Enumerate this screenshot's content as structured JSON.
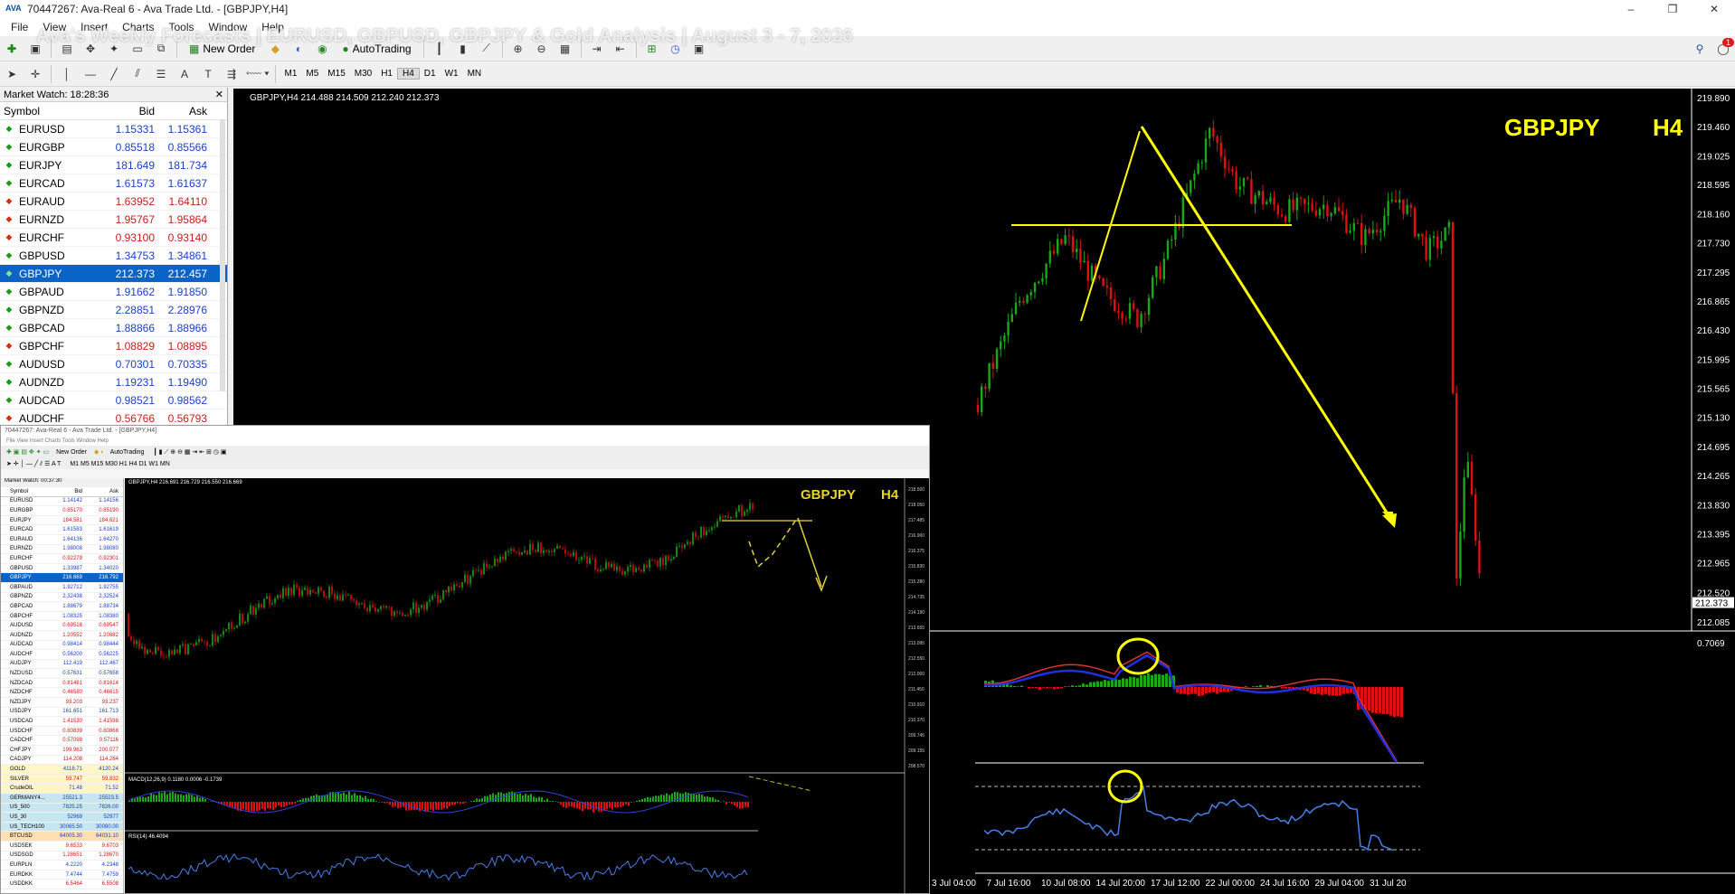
{
  "window": {
    "title": "70447267: Ava-Real 6 - Ava Trade Ltd. - [GBPJPY,H4]",
    "logo": "AVA",
    "controls": [
      "–",
      "❐",
      "✕"
    ]
  },
  "overlay_title": "Ava's Weekly Forecasts | EURUSD, GBPUSD, GBPJPY & Gold Analysis | August 3 - 7, 2026",
  "menu": [
    "File",
    "View",
    "Insert",
    "Charts",
    "Tools",
    "Window",
    "Help"
  ],
  "toolbar": {
    "new_order": "New Order",
    "auto_trading": "AutoTrading",
    "notification_count": "1"
  },
  "timeframes": [
    "M1",
    "M5",
    "M15",
    "M30",
    "H1",
    "H4",
    "D1",
    "W1",
    "MN"
  ],
  "active_timeframe": "H4",
  "market_watch": {
    "header": "Market Watch: 18:28:36",
    "close": "✕",
    "columns": [
      "Symbol",
      "Bid",
      "Ask"
    ],
    "rows": [
      {
        "symbol": "EURUSD",
        "bid": "1.15331",
        "ask": "1.15361",
        "dir": "up"
      },
      {
        "symbol": "EURGBP",
        "bid": "0.85518",
        "ask": "0.85566",
        "dir": "up"
      },
      {
        "symbol": "EURJPY",
        "bid": "181.649",
        "ask": "181.734",
        "dir": "up"
      },
      {
        "symbol": "EURCAD",
        "bid": "1.61573",
        "ask": "1.61637",
        "dir": "up"
      },
      {
        "symbol": "EURAUD",
        "bid": "1.63952",
        "ask": "1.64110",
        "dir": "dn"
      },
      {
        "symbol": "EURNZD",
        "bid": "1.95767",
        "ask": "1.95864",
        "dir": "dn"
      },
      {
        "symbol": "EURCHF",
        "bid": "0.93100",
        "ask": "0.93140",
        "dir": "dn"
      },
      {
        "symbol": "GBPUSD",
        "bid": "1.34753",
        "ask": "1.34861",
        "dir": "up"
      },
      {
        "symbol": "GBPJPY",
        "bid": "212.373",
        "ask": "212.457",
        "dir": "up",
        "selected": true
      },
      {
        "symbol": "GBPAUD",
        "bid": "1.91662",
        "ask": "1.91850",
        "dir": "up"
      },
      {
        "symbol": "GBPNZD",
        "bid": "2.28851",
        "ask": "2.28976",
        "dir": "up"
      },
      {
        "symbol": "GBPCAD",
        "bid": "1.88866",
        "ask": "1.88966",
        "dir": "up"
      },
      {
        "symbol": "GBPCHF",
        "bid": "1.08829",
        "ask": "1.08895",
        "dir": "dn"
      },
      {
        "symbol": "AUDUSD",
        "bid": "0.70301",
        "ask": "0.70335",
        "dir": "up"
      },
      {
        "symbol": "AUDNZD",
        "bid": "1.19231",
        "ask": "1.19490",
        "dir": "up"
      },
      {
        "symbol": "AUDCAD",
        "bid": "0.98521",
        "ask": "0.98562",
        "dir": "up"
      },
      {
        "symbol": "AUDCHF",
        "bid": "0.56766",
        "ask": "0.56793",
        "dir": "dn"
      }
    ]
  },
  "main_chart": {
    "info": "GBPJPY,H4  214.488 214.509 212.240 212.373",
    "symbol_label": "GBPJPY",
    "tf_label": "H4",
    "price_labels": [
      "219.890",
      "219.460",
      "219.025",
      "218.595",
      "218.160",
      "217.730",
      "217.295",
      "216.865",
      "216.430",
      "215.995",
      "215.565",
      "215.130",
      "214.695",
      "214.265",
      "213.830",
      "213.395",
      "212.965",
      "212.520",
      "212.373",
      "212.085"
    ],
    "current_price": "212.373",
    "macd_label": "0.7069",
    "time_labels": [
      "3 Jul 04:00",
      "7 Jul 16:00",
      "10 Jul 08:00",
      "14 Jul 20:00",
      "17 Jul 12:00",
      "22 Jul 00:00",
      "24 Jul 16:00",
      "29 Jul 04:00",
      "31 Jul 20"
    ]
  },
  "inset": {
    "title": "70447267: Ava-Real 6 - Ava Trade Ltd. - [GBPJPY,H4]",
    "menu": "File   View   Insert   Charts   Tools   Window   Help",
    "new_order": "New Order",
    "auto_trading": "AutoTrading",
    "timeframes": "M1  M5  M15  M30  H1  H4  D1  W1  MN",
    "mw_header": "Market Watch: 00:37:30",
    "chart_info": "GBPJPY,H4  216.691 216.729 216.550 216.669",
    "symbol_label": "GBPJPY",
    "tf_label": "H4",
    "macd_info": "MACD(12,26,9) 0.1180 0.0006 -0.1739",
    "rsi_info": "RSI(14) 46.4094",
    "mw_columns": [
      "Symbol",
      "Bid",
      "Ask"
    ],
    "mw_rows": [
      {
        "symbol": "EURUSD",
        "bid": "1.14142",
        "ask": "1.14156",
        "dir": "up"
      },
      {
        "symbol": "EURGBP",
        "bid": "0.85170",
        "ask": "0.85190",
        "dir": "dn"
      },
      {
        "symbol": "EURJPY",
        "bid": "184.581",
        "ask": "184.621",
        "dir": "dn"
      },
      {
        "symbol": "EURCAD",
        "bid": "1.61583",
        "ask": "1.61619",
        "dir": "up"
      },
      {
        "symbol": "EURAUD",
        "bid": "1.64136",
        "ask": "1.64270",
        "dir": "up"
      },
      {
        "symbol": "EURNZD",
        "bid": "1.98008",
        "ask": "1.98080",
        "dir": "up"
      },
      {
        "symbol": "EURCHF",
        "bid": "0.92279",
        "ask": "0.92301",
        "dir": "dn"
      },
      {
        "symbol": "GBPUSD",
        "bid": "1.33987",
        "ask": "1.34020",
        "dir": "up"
      },
      {
        "symbol": "GBPJPY",
        "bid": "216.669",
        "ask": "216.792",
        "dir": "up",
        "selected": true
      },
      {
        "symbol": "GBPAUD",
        "bid": "1.92712",
        "ask": "1.92755",
        "dir": "up"
      },
      {
        "symbol": "GBPNZD",
        "bid": "2.32438",
        "ask": "2.32524",
        "dir": "up"
      },
      {
        "symbol": "GBPCAD",
        "bid": "1.88679",
        "ask": "1.88734",
        "dir": "up"
      },
      {
        "symbol": "GBPCHF",
        "bid": "1.08325",
        "ask": "1.08380",
        "dir": "up"
      },
      {
        "symbol": "AUDUSD",
        "bid": "0.69518",
        "ask": "0.69547",
        "dir": "dn"
      },
      {
        "symbol": "AUDNZD",
        "bid": "1.20552",
        "ask": "1.20882",
        "dir": "dn"
      },
      {
        "symbol": "AUDCAD",
        "bid": "0.98414",
        "ask": "0.98444",
        "dir": "up"
      },
      {
        "symbol": "AUDCHF",
        "bid": "0.56200",
        "ask": "0.56225",
        "dir": "up"
      },
      {
        "symbol": "AUDJPY",
        "bid": "112.419",
        "ask": "112.467",
        "dir": "up"
      },
      {
        "symbol": "NZDUSD",
        "bid": "0.57631",
        "ask": "0.57658",
        "dir": "up"
      },
      {
        "symbol": "NZDCAD",
        "bid": "0.81481",
        "ask": "0.81614",
        "dir": "dn"
      },
      {
        "symbol": "NZDCHF",
        "bid": "0.46580",
        "ask": "0.46615",
        "dir": "dn"
      },
      {
        "symbol": "NZDJPY",
        "bid": "93.203",
        "ask": "93.237",
        "dir": "dn"
      },
      {
        "symbol": "USDJPY",
        "bid": "161.651",
        "ask": "161.713",
        "dir": "up"
      },
      {
        "symbol": "USDCAD",
        "bid": "1.41530",
        "ask": "1.41598",
        "dir": "dn"
      },
      {
        "symbol": "USDCHF",
        "bid": "0.80839",
        "ask": "0.80868",
        "dir": "dn"
      },
      {
        "symbol": "CADCHF",
        "bid": "0.57098",
        "ask": "0.57116",
        "dir": "dn"
      },
      {
        "symbol": "CHFJPY",
        "bid": "199.963",
        "ask": "200.077",
        "dir": "dn"
      },
      {
        "symbol": "CADJPY",
        "bid": "114.208",
        "ask": "114.264",
        "dir": "dn"
      },
      {
        "symbol": "GOLD",
        "bid": "4118.71",
        "ask": "4120.24",
        "dir": "up",
        "kind": "gold"
      },
      {
        "symbol": "SILVER",
        "bid": "59.747",
        "ask": "59.832",
        "dir": "dn",
        "kind": "gold"
      },
      {
        "symbol": "CrudeOIL",
        "bid": "71.48",
        "ask": "71.52",
        "dir": "up",
        "kind": "gold"
      },
      {
        "symbol": "GERMANY4...",
        "bid": "25521.3",
        "ask": "25523.5",
        "dir": "up",
        "kind": "idx"
      },
      {
        "symbol": "US_500",
        "bid": "7825.25",
        "ask": "7826.00",
        "dir": "up",
        "kind": "idx"
      },
      {
        "symbol": "US_30",
        "bid": "52969",
        "ask": "52977",
        "dir": "up",
        "kind": "idx"
      },
      {
        "symbol": "US_TECH100",
        "bid": "30065.50",
        "ask": "30080.00",
        "dir": "up",
        "kind": "idx"
      },
      {
        "symbol": "BTCUSD",
        "bid": "64005.30",
        "ask": "64031.10",
        "dir": "up",
        "kind": "crypto"
      },
      {
        "symbol": "USDSEK",
        "bid": "9.6533",
        "ask": "9.6703",
        "dir": "dn"
      },
      {
        "symbol": "USDSGD",
        "bid": "1.28651",
        "ask": "1.28670",
        "dir": "dn"
      },
      {
        "symbol": "EURPLN",
        "bid": "4.2220",
        "ask": "4.2348",
        "dir": "up"
      },
      {
        "symbol": "EURDKK",
        "bid": "7.4744",
        "ask": "7.4759",
        "dir": "up"
      },
      {
        "symbol": "USDDKK",
        "bid": "6.5464",
        "ask": "6.5508",
        "dir": "dn"
      }
    ],
    "price_labels": [
      "218.500",
      "218.050",
      "217.485",
      "216.900",
      "216.375",
      "215.830",
      "215.280",
      "214.735",
      "214.190",
      "213.655",
      "213.095",
      "212.550",
      "212.000",
      "211.450",
      "210.910",
      "210.370",
      "209.745",
      "209.155",
      "208.570"
    ]
  },
  "colors": {
    "bull": "#1aa81a",
    "bear": "#e01010",
    "annotation": "#ffff00",
    "macd_signal": "#e03030",
    "macd_main": "#2030e0",
    "rsi": "#4a7ee8",
    "select": "#0a64c8"
  }
}
